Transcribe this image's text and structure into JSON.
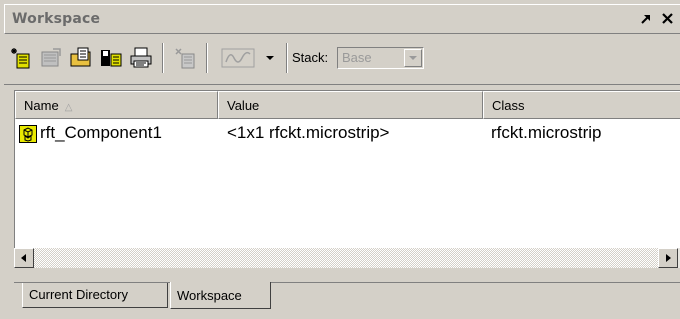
{
  "window": {
    "title": "Workspace",
    "undock_symbol": "↗",
    "close_symbol": "✕"
  },
  "toolbar": {
    "buttons": [
      {
        "name": "new-variable-icon"
      },
      {
        "name": "open-selection-icon"
      },
      {
        "name": "import-data-icon"
      },
      {
        "name": "save-workspace-icon"
      },
      {
        "name": "print-icon"
      },
      {
        "name": "delete-icon"
      },
      {
        "name": "plot-icon"
      },
      {
        "name": "dropdown-arrow-icon"
      }
    ],
    "stack_label": "Stack:",
    "stack_value": "Base"
  },
  "table": {
    "columns": [
      "Name",
      "Value",
      "Class"
    ],
    "sort_indicator": "△",
    "rows": [
      {
        "name": "rft_Component1",
        "value": "<1x1 rfckt.microstrip>",
        "class": "rfckt.microstrip"
      }
    ]
  },
  "tabs": [
    {
      "label": "Current Directory",
      "active": false
    },
    {
      "label": "Workspace",
      "active": true
    }
  ],
  "colors": {
    "chrome": "#d4d0c8",
    "title_text": "#6b6b6b",
    "disabled_text": "#9a9a9a",
    "variable_icon": "#c8c800"
  }
}
